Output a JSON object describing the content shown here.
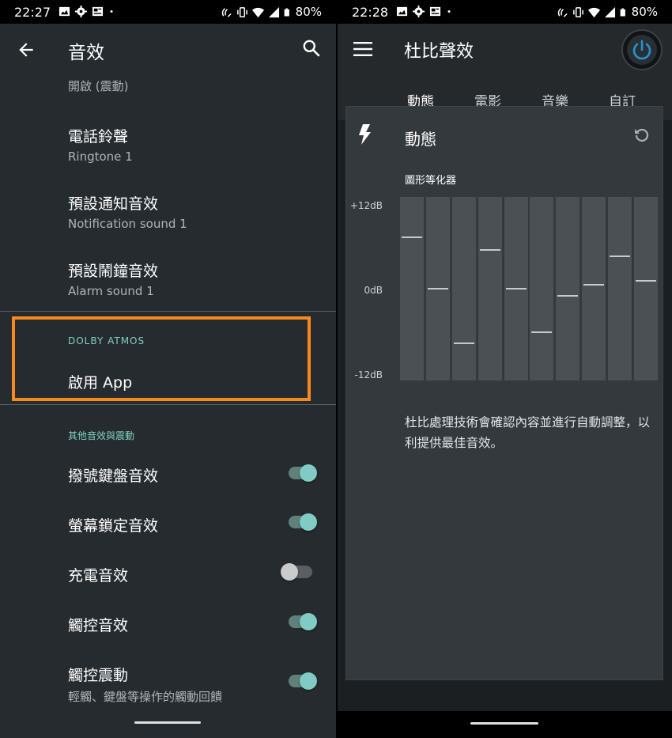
{
  "left": {
    "status": {
      "time": "22:27",
      "battery": "80%"
    },
    "appbar": {
      "title": "音效"
    },
    "top_partial_text": "開啟 (震動)",
    "ringtones": [
      {
        "title": "電話鈴聲",
        "subtitle": "Ringtone 1"
      },
      {
        "title": "預設通知音效",
        "subtitle": "Notification sound 1"
      },
      {
        "title": "預設鬧鐘音效",
        "subtitle": "Alarm sound 1"
      }
    ],
    "dolby_section": {
      "header": "DOLBY ATMOS",
      "item": "啟用 App",
      "highlight_color": "#f68a1f"
    },
    "other_section": {
      "header": "其他音效與震動",
      "items": [
        {
          "title": "撥號鍵盤音效",
          "subtitle": "",
          "enabled": true
        },
        {
          "title": "螢幕鎖定音效",
          "subtitle": "",
          "enabled": true
        },
        {
          "title": "充電音效",
          "subtitle": "",
          "enabled": false
        },
        {
          "title": "觸控音效",
          "subtitle": "",
          "enabled": true
        },
        {
          "title": "觸控震動",
          "subtitle": "輕觸、鍵盤等操作的觸動回饋",
          "enabled": true
        }
      ]
    }
  },
  "right": {
    "status": {
      "time": "22:28",
      "battery": "80%"
    },
    "appbar": {
      "title": "杜比聲效"
    },
    "tabs": [
      "動態",
      "電影",
      "音樂",
      "自訂"
    ],
    "active_tab": 0,
    "card": {
      "title": "動態",
      "eq_label": "圖形等化器",
      "db_labels": {
        "top": "+12dB",
        "mid": "0dB",
        "bottom": "-12dB"
      },
      "eq_levels_db": [
        6.8,
        0.1,
        -7.0,
        5.2,
        0.1,
        -5.6,
        -0.8,
        0.6,
        4.3,
        1.1
      ],
      "description": "杜比處理技術會確認內容並進行自動調整，以利提供最佳音效。"
    },
    "accent_color": "#2196d3"
  }
}
